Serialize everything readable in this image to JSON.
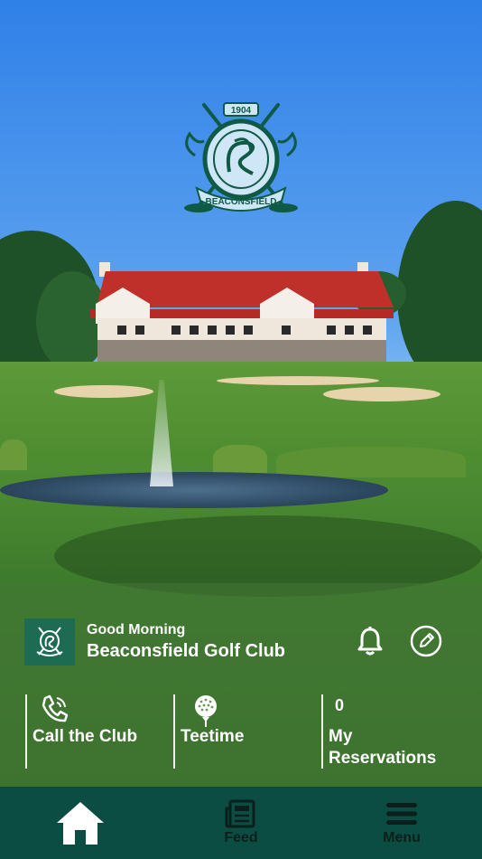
{
  "welcome": {
    "greeting": "Good Morning",
    "club_name": "Beaconsfield Golf Club"
  },
  "actions": [
    {
      "label": "Call the Club",
      "icon": "phone-icon"
    },
    {
      "label": "Teetime",
      "icon": "golf-ball-icon"
    },
    {
      "label_line1": "My",
      "label_line2": "Reservations",
      "count": "0"
    }
  ],
  "header_icons": {
    "notifications": "bell-icon",
    "edit": "pencil-icon"
  },
  "logo": {
    "year": "1904",
    "name": "BEACONSFIELD"
  },
  "nav": [
    {
      "label": "",
      "icon": "home-icon",
      "active": true
    },
    {
      "label": "Feed",
      "icon": "news-icon"
    },
    {
      "label": "Menu",
      "icon": "hamburger-icon"
    }
  ],
  "colors": {
    "brand_green": "#0b4d43",
    "badge_green": "#1c6b52",
    "logo_green": "#0f5a45"
  }
}
